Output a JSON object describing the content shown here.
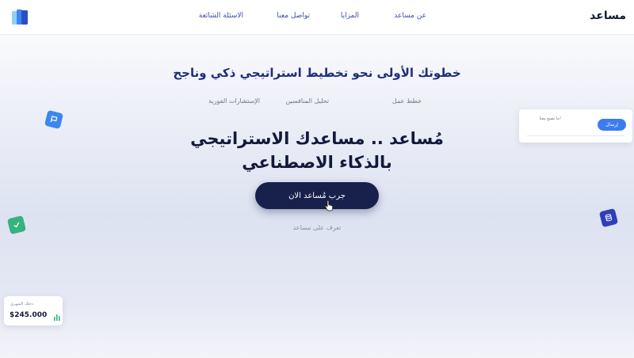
{
  "navbar": {
    "brand": "مساعد",
    "links": {
      "about": "عن مساعد",
      "features": "المزايا",
      "contact": "تواصل معنا",
      "faq": "الاسئلة الشائعة"
    },
    "logo_icon": "book-stack-icon"
  },
  "hero": {
    "headline": "خطوتك الأولى نحو تخطيط استراتيجي ذكي وناجح",
    "subnav": [
      "خطط عمل",
      "تحليل المنافسين",
      "الإستشارات الفورية"
    ],
    "title_line1": "مُساعد .. مساعدك الاستراتيجي",
    "title_line2": "بالذكاء الاصطناعي",
    "cta_label": "جرب مُساعد الان",
    "learn_more": "تعرف على مساعد"
  },
  "contact_card": {
    "label": "ما تضيع معنا!",
    "send_label": "إرسال"
  },
  "income_card": {
    "label": "دخلك الشهري",
    "value": "$245.000"
  },
  "badges": {
    "blue": "flag-icon",
    "green": "check-icon",
    "indigo": "database-icon"
  },
  "colors": {
    "accent_blue": "#3d7bf0",
    "navy": "#17214b",
    "headline": "#1f2d7a",
    "green": "#36b37e",
    "indigo": "#2f3fb6"
  }
}
